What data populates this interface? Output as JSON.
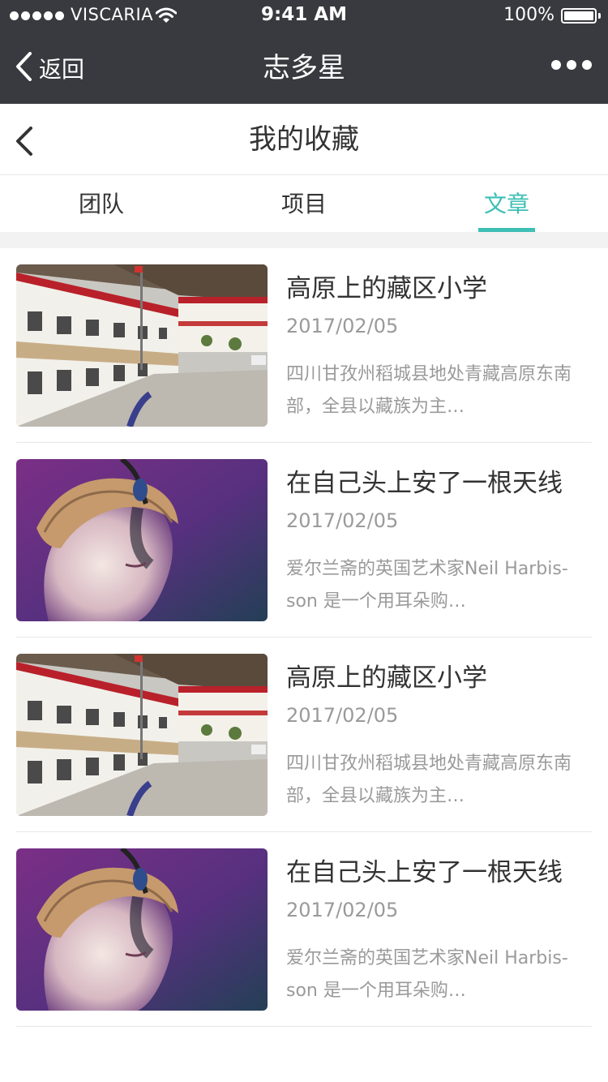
{
  "status_bar": {
    "carrier": "VISCARIA",
    "time": "9:41 AM",
    "battery": "100%"
  },
  "wechat_bar": {
    "back_label": "返回",
    "title": "志多星"
  },
  "page": {
    "title": "我的收藏"
  },
  "tabs": [
    {
      "label": "团队",
      "active": false
    },
    {
      "label": "项目",
      "active": false
    },
    {
      "label": "文章",
      "active": true
    }
  ],
  "accent_color": "#3dbfb4",
  "articles": [
    {
      "title": "高原上的藏区小学",
      "date": "2017/02/05",
      "desc": "四川甘孜州稻城县地处青藏高原东南部，全县以藏族为主…",
      "image": "school-building-photo"
    },
    {
      "title": "在自己头上安了一根天线",
      "date": "2017/02/05",
      "desc": "爱尔兰斋的英国艺术家Neil Harbis-son 是一个用耳朵购…",
      "image": "portrait-with-antenna-photo"
    },
    {
      "title": "高原上的藏区小学",
      "date": "2017/02/05",
      "desc": "四川甘孜州稻城县地处青藏高原东南部，全县以藏族为主…",
      "image": "school-building-photo"
    },
    {
      "title": "在自己头上安了一根天线",
      "date": "2017/02/05",
      "desc": "爱尔兰斋的英国艺术家Neil Harbis-son 是一个用耳朵购…",
      "image": "portrait-with-antenna-photo"
    }
  ]
}
